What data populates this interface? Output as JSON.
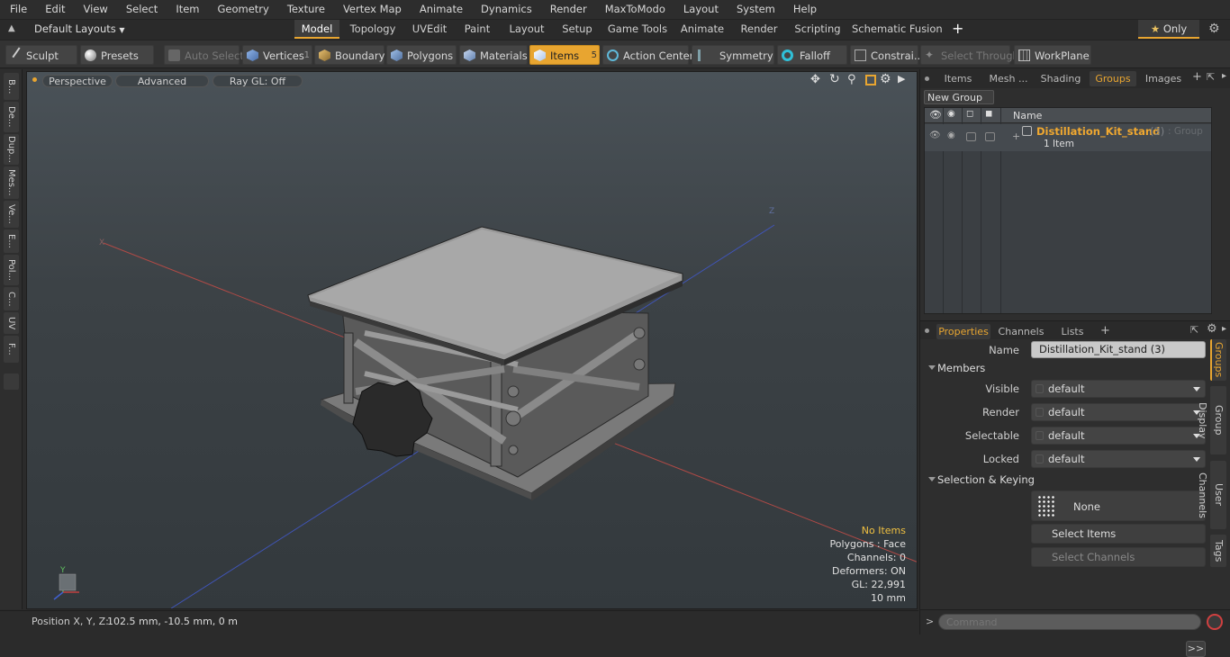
{
  "menu": [
    "File",
    "Edit",
    "View",
    "Select",
    "Item",
    "Geometry",
    "Texture",
    "Vertex Map",
    "Animate",
    "Dynamics",
    "Render",
    "MaxToModo",
    "Layout",
    "System",
    "Help"
  ],
  "layout_bar": {
    "preset_label": "Default Layouts",
    "tabs": [
      "Model",
      "Topology",
      "UVEdit",
      "Paint",
      "Layout",
      "Setup",
      "Game Tools",
      "Animate",
      "Render",
      "Scripting",
      "Schematic Fusion"
    ],
    "active_tab": "Model",
    "add_label": "+",
    "only_label": "Only"
  },
  "toolbar": {
    "sculpt": "Sculpt",
    "presets": "Presets",
    "auto_select": "Auto Select",
    "vertices": "Vertices",
    "vertices_count": "1",
    "boundary": "Boundary",
    "polygons": "Polygons",
    "materials": "Materials",
    "items": "Items",
    "items_count": "5",
    "action_center": "Action Center",
    "symmetry": "Symmetry",
    "falloff": "Falloff",
    "constraints": "Constrai...",
    "select_through": "Select Through",
    "workplane": "WorkPlane"
  },
  "left_tabs": [
    "B...",
    "De...",
    "Dup...",
    "Mes...",
    "Ve...",
    "E...",
    "Pol...",
    "C...",
    "UV",
    "F..."
  ],
  "viewport": {
    "view_mode": "Perspective",
    "shading": "Advanced",
    "raygl": "Ray GL: Off",
    "stats": {
      "items": "No Items",
      "polygons": "Polygons : Face",
      "channels": "Channels: 0",
      "deformers": "Deformers: ON",
      "gl": "GL: 22,991",
      "scale": "10 mm"
    },
    "axis_labels": {
      "x": "X",
      "z": "Z",
      "gizmo_y": "Y"
    }
  },
  "status": {
    "position_label": "Position X, Y, Z:",
    "position_value": "102.5 mm, -10.5 mm, 0 m"
  },
  "groups_panel": {
    "tabs": [
      "Items",
      "Mesh ...",
      "Shading",
      "Groups",
      "Images"
    ],
    "active_tab": "Groups",
    "new_group": "New Group",
    "column_name": "Name",
    "group_name": "Distillation_Kit_stand",
    "group_count": "(3)",
    "group_type": ": Group",
    "group_sub": "1 Item"
  },
  "properties_panel": {
    "tabs": [
      "Properties",
      "Channels",
      "Lists"
    ],
    "active_tab": "Properties",
    "name_label": "Name",
    "name_value": "Distillation_Kit_stand (3)",
    "members_header": "Members",
    "fields": [
      {
        "label": "Visible",
        "value": "default"
      },
      {
        "label": "Render",
        "value": "default"
      },
      {
        "label": "Selectable",
        "value": "default"
      },
      {
        "label": "Locked",
        "value": "default"
      }
    ],
    "selection_header": "Selection & Keying",
    "none_label": "None",
    "select_items": "Select Items",
    "select_channels": "Select Channels",
    "more": ">>",
    "side_tabs": [
      "Groups",
      "Group Display",
      "User Channels",
      "Tags"
    ]
  },
  "command": {
    "prompt": ">",
    "placeholder": "Command"
  },
  "colors": {
    "accent": "#e8a530",
    "viewport_top": "#4a5258",
    "viewport_bottom": "#33393d",
    "x_axis": "#c0504d",
    "z_axis": "#4a63c8"
  }
}
